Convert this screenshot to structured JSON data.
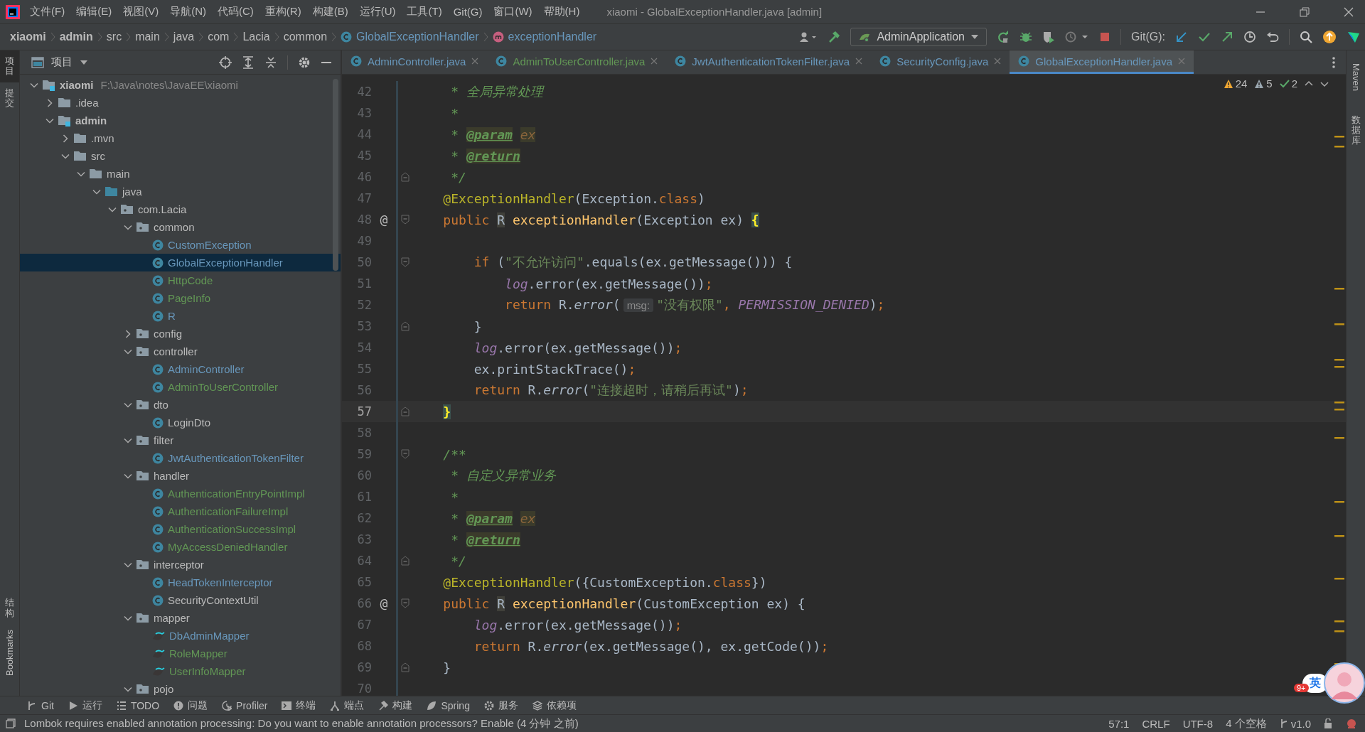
{
  "window": {
    "title": "xiaomi - GlobalExceptionHandler.java [admin]"
  },
  "menu": [
    "文件(F)",
    "编辑(E)",
    "视图(V)",
    "导航(N)",
    "代码(C)",
    "重构(R)",
    "构建(B)",
    "运行(U)",
    "工具(T)",
    "Git(G)",
    "窗口(W)",
    "帮助(H)"
  ],
  "breadcrumbs": [
    {
      "label": "xiaomi",
      "kind": "bold"
    },
    {
      "label": "admin",
      "kind": "bold"
    },
    {
      "label": "src",
      "kind": "plain"
    },
    {
      "label": "main",
      "kind": "plain"
    },
    {
      "label": "java",
      "kind": "plain"
    },
    {
      "label": "com",
      "kind": "plain"
    },
    {
      "label": "Lacia",
      "kind": "plain"
    },
    {
      "label": "common",
      "kind": "plain"
    },
    {
      "label": "GlobalExceptionHandler",
      "kind": "class"
    },
    {
      "label": "exceptionHandler",
      "kind": "method"
    }
  ],
  "toolbar": {
    "run_config": "AdminApplication",
    "git_label": "Git(G):"
  },
  "left_stripe": [
    {
      "label": "项目",
      "selected": true
    },
    {
      "label": "提交",
      "selected": false
    },
    {
      "label": "结构",
      "selected": false
    },
    {
      "label": "Bookmarks",
      "selected": false
    }
  ],
  "right_stripe": [
    {
      "label": "Maven"
    },
    {
      "label": "数据库"
    }
  ],
  "project_panel": {
    "title": "项目"
  },
  "tree": {
    "items": [
      {
        "label": "xiaomi",
        "path": "F:\\Java\\notes\\JavaEE\\xiaomi",
        "kind": "module",
        "expanded": true,
        "selected": false,
        "children": [
          {
            "label": ".idea",
            "kind": "folder",
            "expanded": false,
            "selected": false
          },
          {
            "label": "admin",
            "kind": "module",
            "expanded": true,
            "selected": false,
            "children": [
              {
                "label": ".mvn",
                "kind": "folder",
                "expanded": false,
                "selected": false
              },
              {
                "label": "src",
                "kind": "folder",
                "expanded": true,
                "selected": false,
                "children": [
                  {
                    "label": "main",
                    "kind": "folder",
                    "expanded": true,
                    "selected": false,
                    "children": [
                      {
                        "label": "java",
                        "kind": "source",
                        "expanded": true,
                        "selected": false,
                        "children": [
                          {
                            "label": "com.Lacia",
                            "kind": "package",
                            "expanded": true,
                            "selected": false,
                            "children": [
                              {
                                "label": "common",
                                "kind": "package",
                                "expanded": true,
                                "selected": false,
                                "children": [
                                  {
                                    "label": "CustomException",
                                    "kind": "class",
                                    "color": "#6897bb",
                                    "selected": false
                                  },
                                  {
                                    "label": "GlobalExceptionHandler",
                                    "kind": "class",
                                    "color": "#6897bb",
                                    "selected": true
                                  },
                                  {
                                    "label": "HttpCode",
                                    "kind": "class",
                                    "color": "#629755",
                                    "selected": false
                                  },
                                  {
                                    "label": "PageInfo",
                                    "kind": "class",
                                    "color": "#629755",
                                    "selected": false
                                  },
                                  {
                                    "label": "R",
                                    "kind": "class",
                                    "color": "#6897bb",
                                    "selected": false
                                  }
                                ]
                              },
                              {
                                "label": "config",
                                "kind": "package",
                                "expanded": false,
                                "selected": false
                              },
                              {
                                "label": "controller",
                                "kind": "package",
                                "expanded": true,
                                "selected": false,
                                "children": [
                                  {
                                    "label": "AdminController",
                                    "kind": "class",
                                    "color": "#6897bb",
                                    "selected": false
                                  },
                                  {
                                    "label": "AdminToUserController",
                                    "kind": "class",
                                    "color": "#629755",
                                    "selected": false
                                  }
                                ]
                              },
                              {
                                "label": "dto",
                                "kind": "package",
                                "expanded": true,
                                "selected": false,
                                "children": [
                                  {
                                    "label": "LoginDto",
                                    "kind": "class",
                                    "color": "#bbbbbb",
                                    "selected": false
                                  }
                                ]
                              },
                              {
                                "label": "filter",
                                "kind": "package",
                                "expanded": true,
                                "selected": false,
                                "children": [
                                  {
                                    "label": "JwtAuthenticationTokenFilter",
                                    "kind": "class",
                                    "color": "#6897bb",
                                    "selected": false
                                  }
                                ]
                              },
                              {
                                "label": "handler",
                                "kind": "package",
                                "expanded": true,
                                "selected": false,
                                "children": [
                                  {
                                    "label": "AuthenticationEntryPointImpl",
                                    "kind": "class",
                                    "color": "#629755",
                                    "selected": false
                                  },
                                  {
                                    "label": "AuthenticationFailureImpl",
                                    "kind": "class",
                                    "color": "#629755",
                                    "selected": false
                                  },
                                  {
                                    "label": "AuthenticationSuccessImpl",
                                    "kind": "class",
                                    "color": "#629755",
                                    "selected": false
                                  },
                                  {
                                    "label": "MyAccessDeniedHandler",
                                    "kind": "class",
                                    "color": "#629755",
                                    "selected": false
                                  }
                                ]
                              },
                              {
                                "label": "interceptor",
                                "kind": "package",
                                "expanded": true,
                                "selected": false,
                                "children": [
                                  {
                                    "label": "HeadTokenInterceptor",
                                    "kind": "class",
                                    "color": "#6897bb",
                                    "selected": false
                                  },
                                  {
                                    "label": "SecurityContextUtil",
                                    "kind": "class",
                                    "color": "#bbbbbb",
                                    "selected": false
                                  }
                                ]
                              },
                              {
                                "label": "mapper",
                                "kind": "package",
                                "expanded": true,
                                "selected": false,
                                "children": [
                                  {
                                    "label": "DbAdminMapper",
                                    "kind": "mapper",
                                    "color": "#6897bb",
                                    "selected": false
                                  },
                                  {
                                    "label": "RoleMapper",
                                    "kind": "mapper",
                                    "color": "#629755",
                                    "selected": false
                                  },
                                  {
                                    "label": "UserInfoMapper",
                                    "kind": "mapper",
                                    "color": "#629755",
                                    "selected": false
                                  }
                                ]
                              },
                              {
                                "label": "pojo",
                                "kind": "package",
                                "expanded": true,
                                "selected": false
                              }
                            ]
                          }
                        ]
                      }
                    ]
                  }
                ]
              }
            ]
          }
        ]
      }
    ]
  },
  "editor_tabs": [
    {
      "label": "AdminController.java",
      "color": "#6897bb",
      "selected": false
    },
    {
      "label": "AdminToUserController.java",
      "color": "#629755",
      "selected": false
    },
    {
      "label": "JwtAuthenticationTokenFilter.java",
      "color": "#6897bb",
      "selected": false
    },
    {
      "label": "SecurityConfig.java",
      "color": "#6897bb",
      "selected": false
    },
    {
      "label": "GlobalExceptionHandler.java",
      "color": "#6897bb",
      "selected": true
    }
  ],
  "inspections": [
    {
      "kind": "warning",
      "count": "24"
    },
    {
      "kind": "weak",
      "count": "5"
    },
    {
      "kind": "ok",
      "count": "2"
    }
  ],
  "code_lines": [
    {
      "num": "42",
      "kind": "plain",
      "current": false,
      "tokens": [
        {
          "kind": "comment",
          "text": "     * 全局异常处理"
        }
      ]
    },
    {
      "num": "43",
      "kind": "plain",
      "current": false,
      "tokens": [
        {
          "kind": "comment",
          "text": "     *"
        }
      ]
    },
    {
      "num": "44",
      "kind": "plain",
      "current": false,
      "tokens": [
        {
          "kind": "comment",
          "text": "     * "
        },
        {
          "kind": "tag",
          "text": "@param"
        },
        {
          "kind": "param",
          "text": " ex"
        }
      ]
    },
    {
      "num": "45",
      "kind": "plain",
      "current": false,
      "tokens": [
        {
          "kind": "comment",
          "text": "     * "
        },
        {
          "kind": "tag",
          "text": "@return"
        }
      ]
    },
    {
      "num": "46",
      "kind": "fold-end",
      "current": false,
      "tokens": [
        {
          "kind": "comment",
          "text": "     */"
        }
      ]
    },
    {
      "num": "47",
      "kind": "plain",
      "current": false,
      "tokens": [
        {
          "kind": "annotation",
          "text": "    @ExceptionHandler"
        },
        {
          "kind": "plain",
          "text": "(Exception."
        },
        {
          "kind": "keyword",
          "text": "class"
        },
        {
          "kind": "plain",
          "text": ")"
        }
      ]
    },
    {
      "num": "48",
      "kind": "fold-start",
      "current": false,
      "gutter": "@",
      "tokens": [
        {
          "kind": "keyword",
          "text": "    public "
        },
        {
          "kind": "usage",
          "text": "R"
        },
        {
          "kind": "method",
          "text": " exceptionHandler"
        },
        {
          "kind": "plain",
          "text": "(Exception ex) "
        },
        {
          "kind": "brace",
          "text": "{"
        }
      ]
    },
    {
      "num": "49",
      "kind": "plain",
      "current": false
    },
    {
      "num": "50",
      "kind": "fold-start",
      "current": false,
      "tokens": [
        {
          "kind": "keyword",
          "text": "        if "
        },
        {
          "kind": "plain",
          "text": "("
        },
        {
          "kind": "string",
          "text": "\"不允许访问\""
        },
        {
          "kind": "plain",
          "text": ".equals(ex.getMessage())) {"
        }
      ]
    },
    {
      "num": "51",
      "kind": "plain",
      "current": false,
      "tokens": [
        {
          "kind": "field",
          "text": "            log"
        },
        {
          "kind": "plain",
          "text": ".error(ex.getMessage())"
        },
        {
          "kind": "keyword",
          "text": ";"
        }
      ]
    },
    {
      "num": "52",
      "kind": "plain",
      "current": false,
      "tokens": [
        {
          "kind": "keyword",
          "text": "            return "
        },
        {
          "kind": "plain",
          "text": "R."
        },
        {
          "kind": "italic",
          "text": "error"
        },
        {
          "kind": "plain",
          "text": "("
        },
        {
          "kind": "hint",
          "text": "msg:"
        },
        {
          "kind": "string",
          "text": "\"没有权限\""
        },
        {
          "kind": "keyword",
          "text": ", "
        },
        {
          "kind": "constant",
          "text": "PERMISSION_DENIED"
        },
        {
          "kind": "plain",
          "text": ")"
        },
        {
          "kind": "keyword",
          "text": ";"
        }
      ]
    },
    {
      "num": "53",
      "kind": "fold-end",
      "current": false,
      "tokens": [
        {
          "kind": "plain",
          "text": "        }"
        }
      ]
    },
    {
      "num": "54",
      "kind": "plain",
      "current": false,
      "tokens": [
        {
          "kind": "field",
          "text": "        log"
        },
        {
          "kind": "plain",
          "text": ".error(ex.getMessage())"
        },
        {
          "kind": "keyword",
          "text": ";"
        }
      ]
    },
    {
      "num": "55",
      "kind": "plain",
      "current": false,
      "tokens": [
        {
          "kind": "plain",
          "text": "        ex.printStackTrace()"
        },
        {
          "kind": "keyword",
          "text": ";"
        }
      ]
    },
    {
      "num": "56",
      "kind": "plain",
      "current": false,
      "tokens": [
        {
          "kind": "keyword",
          "text": "        return "
        },
        {
          "kind": "plain",
          "text": "R."
        },
        {
          "kind": "italic",
          "text": "error"
        },
        {
          "kind": "plain",
          "text": "("
        },
        {
          "kind": "string",
          "text": "\"连接超时，请稍后再试\""
        },
        {
          "kind": "plain",
          "text": ")"
        },
        {
          "kind": "keyword",
          "text": ";"
        }
      ]
    },
    {
      "num": "57",
      "kind": "fold-end",
      "current": true,
      "tokens": [
        {
          "kind": "brace",
          "text": "    }"
        }
      ]
    },
    {
      "num": "58",
      "kind": "plain",
      "current": false
    },
    {
      "num": "59",
      "kind": "fold-start",
      "current": false,
      "tokens": [
        {
          "kind": "comment",
          "text": "    /**"
        }
      ]
    },
    {
      "num": "60",
      "kind": "plain",
      "current": false,
      "tokens": [
        {
          "kind": "comment",
          "text": "     * 自定义异常业务"
        }
      ]
    },
    {
      "num": "61",
      "kind": "plain",
      "current": false,
      "tokens": [
        {
          "kind": "comment",
          "text": "     *"
        }
      ]
    },
    {
      "num": "62",
      "kind": "plain",
      "current": false,
      "tokens": [
        {
          "kind": "comment",
          "text": "     * "
        },
        {
          "kind": "tag",
          "text": "@param"
        },
        {
          "kind": "param",
          "text": " ex"
        }
      ]
    },
    {
      "num": "63",
      "kind": "plain",
      "current": false,
      "tokens": [
        {
          "kind": "comment",
          "text": "     * "
        },
        {
          "kind": "tag",
          "text": "@return"
        }
      ]
    },
    {
      "num": "64",
      "kind": "fold-end",
      "current": false,
      "tokens": [
        {
          "kind": "comment",
          "text": "     */"
        }
      ]
    },
    {
      "num": "65",
      "kind": "plain",
      "current": false,
      "tokens": [
        {
          "kind": "annotation",
          "text": "    @ExceptionHandler"
        },
        {
          "kind": "plain",
          "text": "({CustomException."
        },
        {
          "kind": "keyword",
          "text": "class"
        },
        {
          "kind": "plain",
          "text": "})"
        }
      ]
    },
    {
      "num": "66",
      "kind": "fold-start",
      "current": false,
      "gutter": "@",
      "tokens": [
        {
          "kind": "keyword",
          "text": "    public "
        },
        {
          "kind": "usage",
          "text": "R"
        },
        {
          "kind": "method",
          "text": " exceptionHandler"
        },
        {
          "kind": "plain",
          "text": "(CustomException ex) {"
        }
      ]
    },
    {
      "num": "67",
      "kind": "plain",
      "current": false,
      "tokens": [
        {
          "kind": "field",
          "text": "        log"
        },
        {
          "kind": "plain",
          "text": ".error(ex.getMessage())"
        },
        {
          "kind": "keyword",
          "text": ";"
        }
      ]
    },
    {
      "num": "68",
      "kind": "plain",
      "current": false,
      "tokens": [
        {
          "kind": "keyword",
          "text": "        return "
        },
        {
          "kind": "plain",
          "text": "R."
        },
        {
          "kind": "italic",
          "text": "error"
        },
        {
          "kind": "plain",
          "text": "(ex.getMessage(), ex.getCode())"
        },
        {
          "kind": "keyword",
          "text": ";"
        }
      ]
    },
    {
      "num": "69",
      "kind": "fold-end",
      "current": false,
      "tokens": [
        {
          "kind": "plain",
          "text": "    }"
        }
      ]
    },
    {
      "num": "70",
      "kind": "plain",
      "current": false
    }
  ],
  "tool_windows": [
    {
      "label": "Git",
      "kind": "branch"
    },
    {
      "label": "运行",
      "kind": "play"
    },
    {
      "label": "TODO",
      "kind": "list"
    },
    {
      "label": "问题",
      "kind": "alert"
    },
    {
      "label": "Profiler",
      "kind": "profiler"
    },
    {
      "label": "终端",
      "kind": "terminal"
    },
    {
      "label": "端点",
      "kind": "endpoints"
    },
    {
      "label": "构建",
      "kind": "hammer"
    },
    {
      "label": "Spring",
      "kind": "leaf"
    },
    {
      "label": "服务",
      "kind": "services"
    },
    {
      "label": "依赖项",
      "kind": "layers"
    }
  ],
  "status_bar": {
    "message": "Lombok requires enabled annotation processing: Do you want to enable annotation processors? Enable (4 分钟 之前)",
    "items": [
      "57:1",
      "CRLF",
      "UTF-8",
      "4 个空格"
    ],
    "branch": "v1.0"
  },
  "ime": {
    "label": "英",
    "badge": "9+"
  }
}
